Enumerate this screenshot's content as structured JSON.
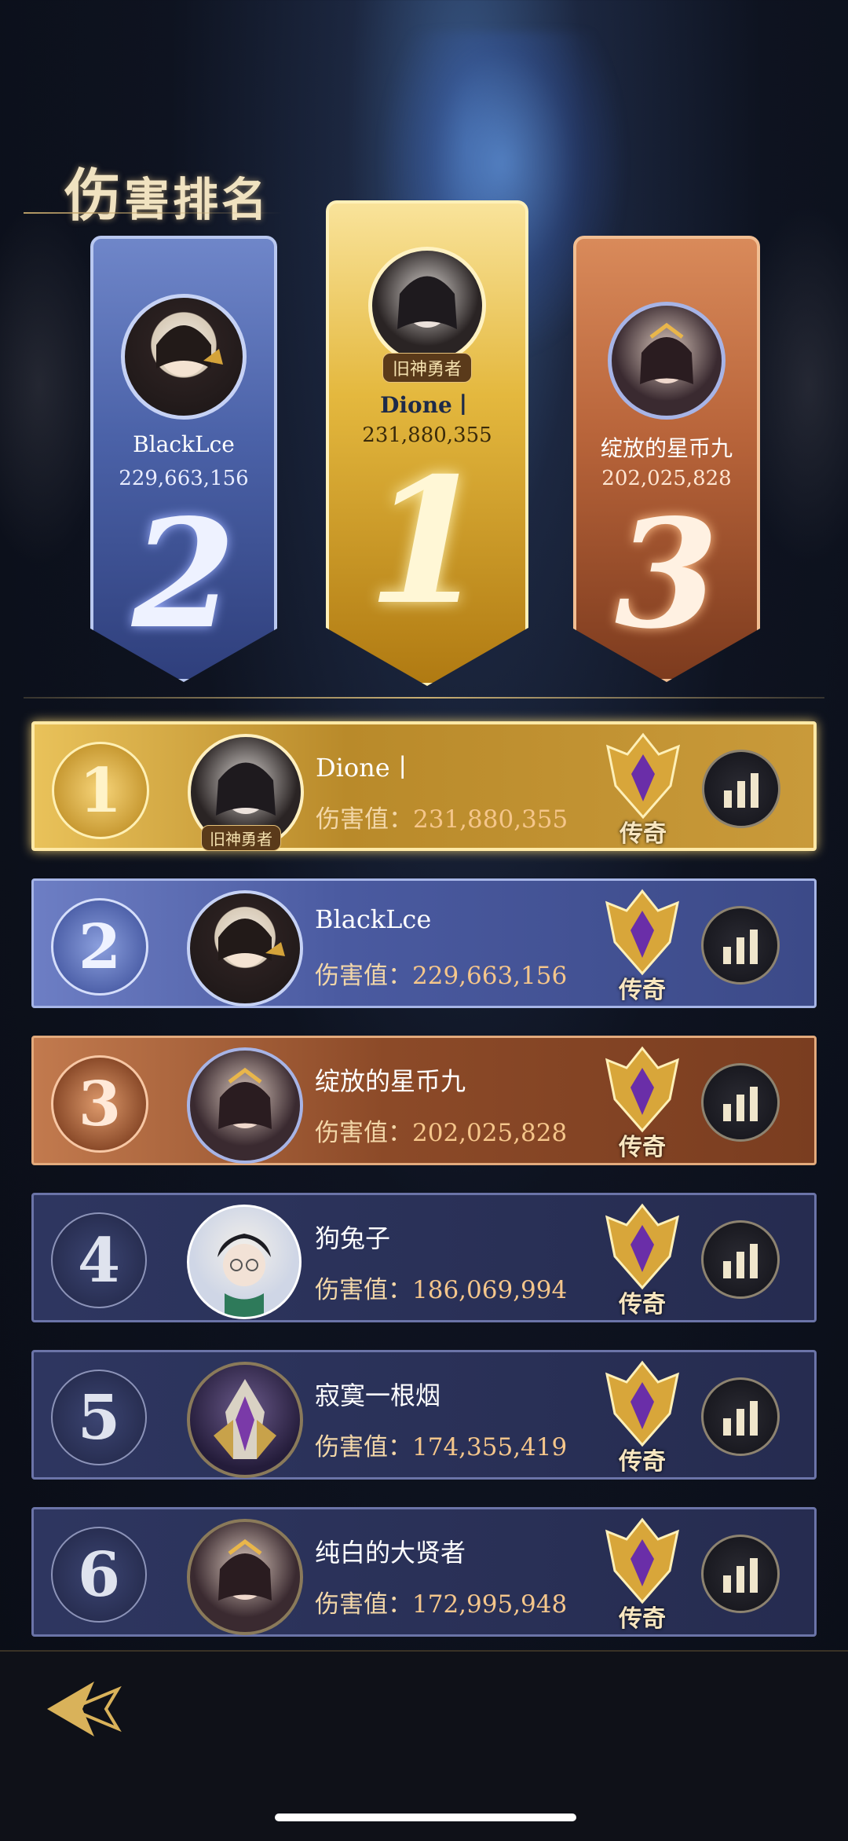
{
  "title": {
    "first_char": "伤",
    "rest": "害排名"
  },
  "podium": [
    {
      "rank_label": "2",
      "name": "BlackLce",
      "score": "229,663,156",
      "avatar_tag": ""
    },
    {
      "rank_label": "1",
      "name": "Dione丨",
      "score": "231,880,355",
      "avatar_tag": "旧神勇者"
    },
    {
      "rank_label": "3",
      "name": "绽放的星币九",
      "score": "202,025,828",
      "avatar_tag": ""
    }
  ],
  "damage_label": "伤害值：",
  "ranking": [
    {
      "rank": "1",
      "name": "Dione丨",
      "damage": "231,880,355",
      "tier": "传奇",
      "avatar_tag": "旧神勇者"
    },
    {
      "rank": "2",
      "name": "BlackLce",
      "damage": "229,663,156",
      "tier": "传奇"
    },
    {
      "rank": "3",
      "name": "绽放的星币九",
      "damage": "202,025,828",
      "tier": "传奇"
    },
    {
      "rank": "4",
      "name": "狗兔子",
      "damage": "186,069,994",
      "tier": "传奇"
    },
    {
      "rank": "5",
      "name": "寂寞一根烟",
      "damage": "174,355,419",
      "tier": "传奇"
    },
    {
      "rank": "6",
      "name": "纯白的大贤者",
      "damage": "172,995,948",
      "tier": "传奇"
    }
  ],
  "icons": {
    "back": "back-arrow-icon",
    "stats": "bar-chart-icon",
    "tier": "legend-tier-emblem-icon"
  },
  "colors": {
    "gold": "#e4b83e",
    "silver_blue": "#4b62a8",
    "bronze": "#b8643a",
    "row_default": "#2e3660",
    "damage_text": "#f5c68b"
  }
}
